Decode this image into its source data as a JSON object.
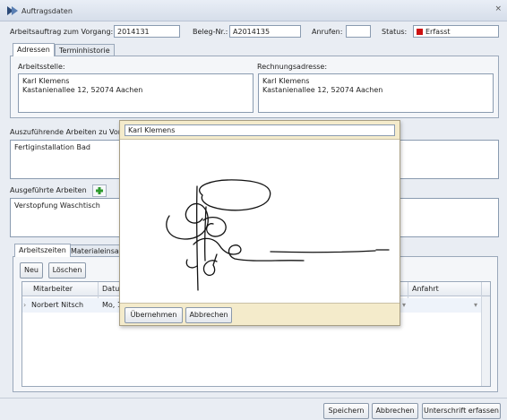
{
  "window": {
    "title": "Auftragsdaten",
    "close_glyph": "×"
  },
  "header": {
    "arbeitsauftrag_label": "Arbeitsauftrag zum Vorgang:",
    "arbeitsauftrag_value": "2014131",
    "beleg_label": "Beleg-Nr.:",
    "beleg_value": "A2014135",
    "anrufen_label": "Anrufen:",
    "anrufen_value": "",
    "status_label": "Status:",
    "status_value": "Erfasst",
    "status_color": "#cc1111"
  },
  "top_tabs": [
    {
      "label": "Adressen"
    },
    {
      "label": "Terminhistorie"
    }
  ],
  "addresses": {
    "arbeitsstelle_label": "Arbeitsstelle:",
    "arbeitsstelle_name": "Karl Klemens",
    "arbeitsstelle_street": "Kastanienallee 12, 52074 Aachen",
    "rechnung_label": "Rechnungsadresse:",
    "rechnung_name": "Karl Klemens",
    "rechnung_street": "Kastanienallee 12, 52074 Aachen"
  },
  "auszufuehrende": {
    "label": "Auszuführende Arbeiten zu Vorg",
    "text": "Fertiginstallation Bad"
  },
  "ausgefuehrte": {
    "label": "Ausgeführte Arbeiten",
    "add_icon": "plus-icon",
    "text": "Verstopfung Waschtisch"
  },
  "bottom_tabs": [
    {
      "label": "Arbeitszeiten"
    },
    {
      "label": "Materialeinsat"
    }
  ],
  "grid_toolbar": {
    "new_label": "Neu",
    "delete_label": "Löschen"
  },
  "grid": {
    "columns": [
      "Mitarbeiter",
      "Datum",
      "Anfahrt"
    ],
    "rows": [
      {
        "mitarbeiter": "Norbert Nitsch",
        "datum": "Mo, 1"
      }
    ]
  },
  "footer": {
    "save_label": "Speichern",
    "cancel_label": "Abbrechen",
    "signature_label": "Unterschrift erfassen"
  },
  "dialog": {
    "name_value": "Karl Klemens",
    "accept_label": "Übernehmen",
    "cancel_label": "Abbrechen"
  }
}
